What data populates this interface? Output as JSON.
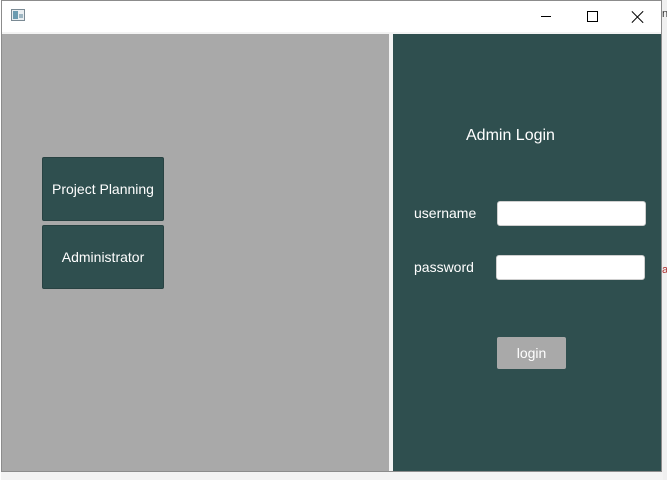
{
  "background": {
    "edge_text_top": "n",
    "edge_text_right": "a"
  },
  "window": {
    "title": "",
    "controls": {
      "minimize": "minimize",
      "maximize": "maximize",
      "close": "close"
    }
  },
  "sidebar": {
    "buttons": [
      {
        "label": "Project Planning"
      },
      {
        "label": "Administrator"
      }
    ]
  },
  "login_panel": {
    "title": "Admin Login",
    "username_label": "username",
    "password_label": "password",
    "username_value": "",
    "password_value": "",
    "login_label": "login"
  },
  "colors": {
    "panel": "#2f4f4f",
    "left_background": "#a9a9a9",
    "login_button": "#a9a9a9"
  }
}
